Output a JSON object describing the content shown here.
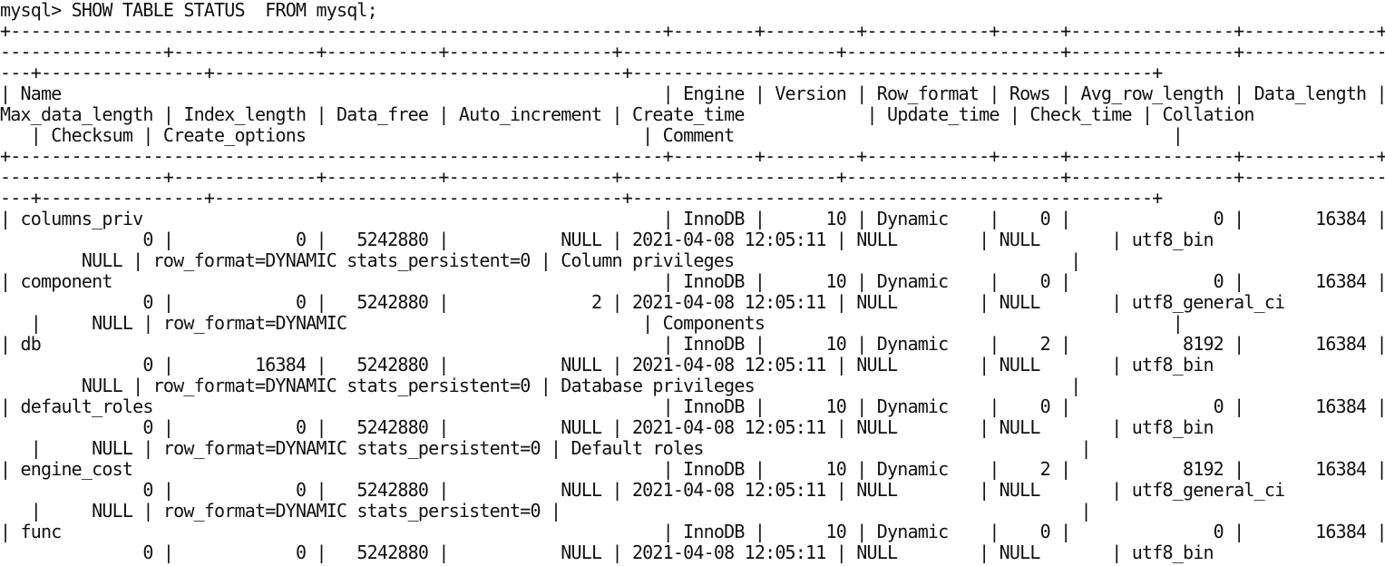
{
  "terminal": {
    "lines": [
      "mysql> SHOW TABLE STATUS  FROM mysql;",
      "+----------------------------------------------------------------+--------+---------+------------+------+----------------+-------------+-",
      "----------------+--------------+-----------+----------------+---------------------+---------------------+----------------+--------------+-",
      "---+----------------+----------------------------------------+---------------------------------------------------+",
      "| Name                                                           | Engine | Version | Row_format | Rows | Avg_row_length | Data_length |",
      "Max_data_length | Index_length | Data_free | Auto_increment | Create_time            | Update_time | Check_time | Collation",
      "   | Checksum | Create_options                                 | Comment                                           |",
      "+----------------------------------------------------------------+--------+---------+------------+------+----------------+-------------+-",
      "----------------+--------------+-----------+----------------+---------------------+---------------------+----------------+--------------+-",
      "---+----------------+----------------------------------------+---------------------------------------------------+",
      "| columns_priv                                                   | InnoDB |      10 | Dynamic    |    0 |              0 |       16384 |",
      "              0 |            0 |   5242880 |           NULL | 2021-04-08 12:05:11 | NULL        | NULL       | utf8_bin",
      "        NULL | row_format=DYNAMIC stats_persistent=0 | Column privileges                                 |",
      "| component                                                      | InnoDB |      10 | Dynamic    |    0 |              0 |       16384 |",
      "              0 |            0 |   5242880 |              2 | 2021-04-08 12:05:11 | NULL        | NULL       | utf8_general_ci",
      "   |     NULL | row_format=DYNAMIC                             | Components                                        |",
      "| db                                                             | InnoDB |      10 | Dynamic    |    2 |           8192 |       16384 |",
      "              0 |        16384 |   5242880 |           NULL | 2021-04-08 12:05:11 | NULL        | NULL       | utf8_bin",
      "        NULL | row_format=DYNAMIC stats_persistent=0 | Database privileges                               |",
      "| default_roles                                                  | InnoDB |      10 | Dynamic    |    0 |              0 |       16384 |",
      "              0 |            0 |   5242880 |           NULL | 2021-04-08 12:05:11 | NULL        | NULL       | utf8_bin",
      "   |     NULL | row_format=DYNAMIC stats_persistent=0 | Default roles                                     |",
      "| engine_cost                                                    | InnoDB |      10 | Dynamic    |    2 |           8192 |       16384 |",
      "              0 |            0 |   5242880 |           NULL | 2021-04-08 12:05:11 | NULL        | NULL       | utf8_general_ci",
      "   |     NULL | row_format=DYNAMIC stats_persistent=0 |                                                   |",
      "| func                                                           | InnoDB |      10 | Dynamic    |    0 |              0 |       16384 |",
      "              0 |            0 |   5242880 |           NULL | 2021-04-08 12:05:11 | NULL        | NULL       | utf8_bin"
    ]
  }
}
